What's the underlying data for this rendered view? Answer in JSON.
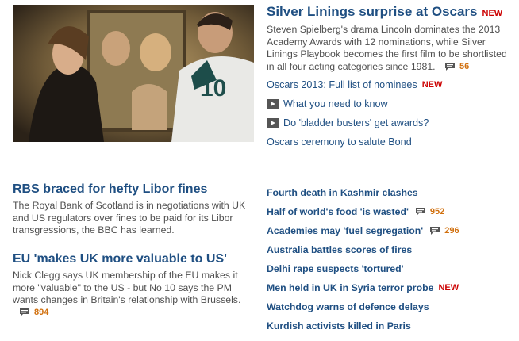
{
  "top_story": {
    "headline": "Silver Linings surprise at Oscars",
    "new_badge": "NEW",
    "summary": "Steven Spielberg's drama Lincoln dominates the 2013 Academy Awards with 12 nominations, while Silver Linings Playbook becomes the first film to be shortlisted in all four acting categories since 1981.",
    "comment_count": "56",
    "links": [
      {
        "label": "Oscars 2013: Full list of nominees",
        "badge": "NEW"
      },
      {
        "label": "What you need to know",
        "icon": "video-play-icon"
      },
      {
        "label": "Do 'bladder busters' get awards?",
        "icon": "video-play-icon"
      },
      {
        "label": "Oscars ceremony to salute Bond"
      }
    ]
  },
  "stories": [
    {
      "headline": "RBS braced for hefty Libor fines",
      "summary": "The Royal Bank of Scotland is in negotiations with UK and US regulators over fines to be paid for its Libor transgressions, the BBC has learned."
    },
    {
      "headline": "EU 'makes UK more valuable to US'",
      "summary": "Nick Clegg says UK membership of the EU makes it more \"valuable\" to the US - but No 10 says the PM wants changes in Britain's relationship with Brussels.",
      "comment_count": "894"
    }
  ],
  "headlines": [
    {
      "label": "Fourth death in Kashmir clashes"
    },
    {
      "label": "Half of world's food 'is wasted'",
      "comment_count": "952"
    },
    {
      "label": "Academies may 'fuel segregation'",
      "comment_count": "296"
    },
    {
      "label": "Australia battles scores of fires"
    },
    {
      "label": "Delhi rape suspects 'tortured'"
    },
    {
      "label": "Men held in UK in Syria terror probe",
      "badge": "NEW"
    },
    {
      "label": "Watchdog warns of defence delays"
    },
    {
      "label": "Kurdish activists killed in Paris"
    }
  ],
  "colors": {
    "link": "#1f4f82",
    "new_badge": "#cc0000",
    "comment_count": "#d1700e",
    "body_text": "#505050"
  }
}
